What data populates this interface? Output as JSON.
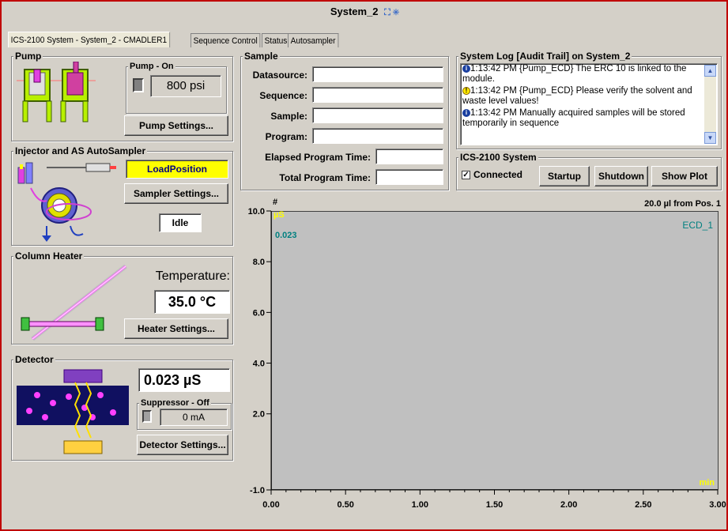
{
  "window": {
    "title": "System_2"
  },
  "tabs": [
    {
      "label": "ICS-2100 System - System_2 - CMADLER1"
    },
    {
      "label": "Sequence Control"
    },
    {
      "label": "Status"
    },
    {
      "label": "Autosampler"
    }
  ],
  "pump": {
    "group_title": "Pump",
    "status_title": "Pump - On",
    "pressure": "800 psi",
    "settings_button": "Pump Settings..."
  },
  "injector": {
    "group_title": "Injector and AS AutoSampler",
    "position": "LoadPosition",
    "settings_button": "Sampler Settings...",
    "status": "Idle"
  },
  "column_heater": {
    "group_title": "Column Heater",
    "temp_label": "Temperature:",
    "temperature": "35.0 °C",
    "settings_button": "Heater Settings..."
  },
  "detector": {
    "group_title": "Detector",
    "conductivity": "0.023 µS",
    "suppressor_title": "Suppressor - Off",
    "suppressor_current": "0 mA",
    "settings_button": "Detector Settings..."
  },
  "sample": {
    "group_title": "Sample",
    "fields": [
      {
        "label": "Datasource:",
        "value": ""
      },
      {
        "label": "Sequence:",
        "value": ""
      },
      {
        "label": "Sample:",
        "value": ""
      },
      {
        "label": "Program:",
        "value": ""
      }
    ],
    "elapsed_label": "Elapsed Program Time:",
    "elapsed_value": "",
    "total_label": "Total Program Time:",
    "total_value": ""
  },
  "system_log": {
    "group_title": "System Log [Audit Trail] on System_2",
    "entries": [
      {
        "type": "info",
        "text": "1:13:42 PM {Pump_ECD} The ERC 10 is linked to the module."
      },
      {
        "type": "warning",
        "text": "1:13:42 PM {Pump_ECD} Please verify the solvent and waste level values!"
      },
      {
        "type": "info",
        "text": "1:13:42 PM Manually acquired samples will be stored temporarily in sequence"
      }
    ]
  },
  "ics_system": {
    "group_title": "ICS-2100 System",
    "connected_label": "Connected",
    "connected": true,
    "startup_button": "Startup",
    "shutdown_button": "Shutdown",
    "show_plot_button": "Show Plot"
  },
  "plot": {
    "y_symbol": "#",
    "unit": "µS",
    "current_value": "0.023",
    "injection_info": "20.0 µl from Pos. 1",
    "channel": "ECD_1",
    "x_unit": "min"
  },
  "colors": {
    "accent_yellow": "#ffff00",
    "teal": "#008080",
    "frame_red": "#c00000",
    "plot_bg": "#c0c0c0"
  },
  "chart_data": {
    "type": "line",
    "title": "",
    "xlabel": "min",
    "ylabel": "µS",
    "xlim": [
      0.0,
      3.0
    ],
    "ylim": [
      -1.0,
      10.0
    ],
    "x_ticks": [
      "0.00",
      "0.50",
      "1.00",
      "1.50",
      "2.00",
      "2.50",
      "3.00"
    ],
    "y_ticks": [
      "-1.0",
      "2.0",
      "4.0",
      "6.0",
      "8.0",
      "10.0"
    ],
    "series": [
      {
        "name": "ECD_1",
        "x": [],
        "y": []
      }
    ],
    "grid": false
  }
}
